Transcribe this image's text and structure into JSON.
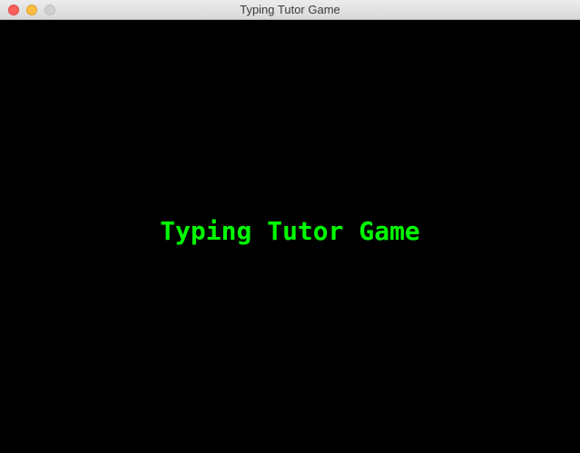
{
  "window": {
    "title": "Typing Tutor Game"
  },
  "game": {
    "title_text": "Typing Tutor Game",
    "background_color": "#000000",
    "text_color": "#00ff00"
  }
}
